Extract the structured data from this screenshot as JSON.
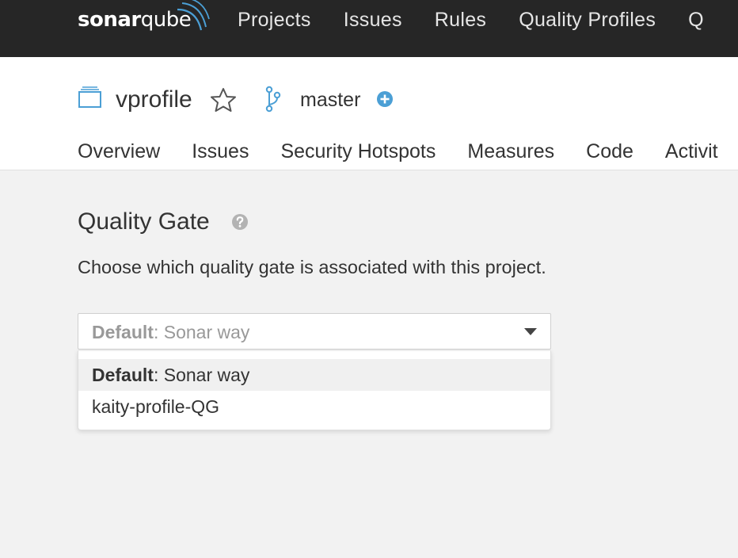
{
  "app": {
    "logo_bold": "sonar",
    "logo_light": "qube"
  },
  "topnav": {
    "items": [
      "Projects",
      "Issues",
      "Rules",
      "Quality Profiles",
      "Q"
    ]
  },
  "project": {
    "name": "vprofile",
    "branch": "master",
    "tabs": [
      "Overview",
      "Issues",
      "Security Hotspots",
      "Measures",
      "Code",
      "Activit"
    ]
  },
  "quality_gate": {
    "title": "Quality Gate",
    "description": "Choose which quality gate is associated with this project.",
    "selected": {
      "prefix": "Default",
      "separator": ": ",
      "name": "Sonar way"
    },
    "options": [
      {
        "prefix": "Default",
        "separator": ": ",
        "name": "Sonar way",
        "focused": true
      },
      {
        "prefix": "",
        "separator": "",
        "name": "kaity-profile-QG",
        "focused": false
      }
    ]
  },
  "colors": {
    "navbar": "#262626",
    "accent_blue": "#4b9fd5",
    "page_bg": "#f2f2f2"
  },
  "icons": {
    "project": "project-icon",
    "favorite": "star-icon",
    "branch": "branch-icon",
    "add_branch": "plus-circle-icon",
    "help": "help-icon",
    "dropdown": "caret-down-icon"
  }
}
